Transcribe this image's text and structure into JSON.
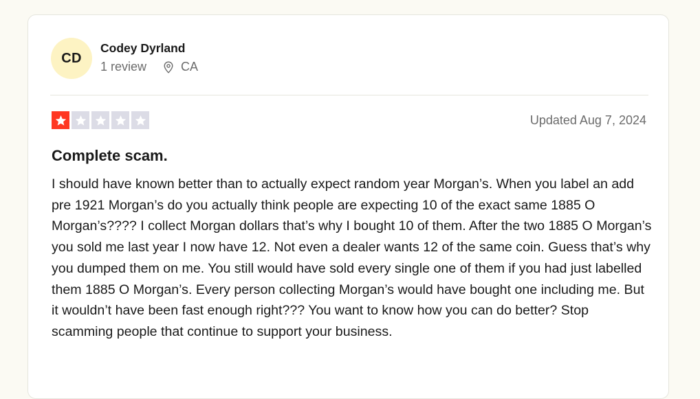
{
  "consumer": {
    "initials": "CD",
    "name": "Codey Dyrland",
    "review_count": "1 review",
    "location": "CA"
  },
  "review": {
    "rating": 1,
    "max_rating": 5,
    "date": "Updated Aug 7, 2024",
    "title": "Complete scam.",
    "body": "I should have known better than to actually expect random year Morgan’s. When you label an add pre 1921 Morgan’s do you actually think people are expecting 10 of the exact same 1885 O Morgan’s???? I collect Morgan dollars that’s why I bought 10 of them. After the two 1885 O Morgan’s you sold me last year I now have 12. Not even a dealer wants 12 of the same coin. Guess that’s why you dumped them on me. You still would have sold every single one of them if you had just labelled them 1885 O Morgan’s. Every person collecting Morgan’s would have bought one including me. But it wouldn’t have been fast enough right??? You want to know how you can do better? Stop scamming people that continue to support your business."
  },
  "colors": {
    "star_filled": "#ff3722",
    "star_empty": "#dcdce6",
    "avatar_bg": "#fdf3c3",
    "page_bg": "#fbfaf3"
  },
  "icons": {
    "star": "star-icon",
    "location": "location-pin-icon"
  }
}
